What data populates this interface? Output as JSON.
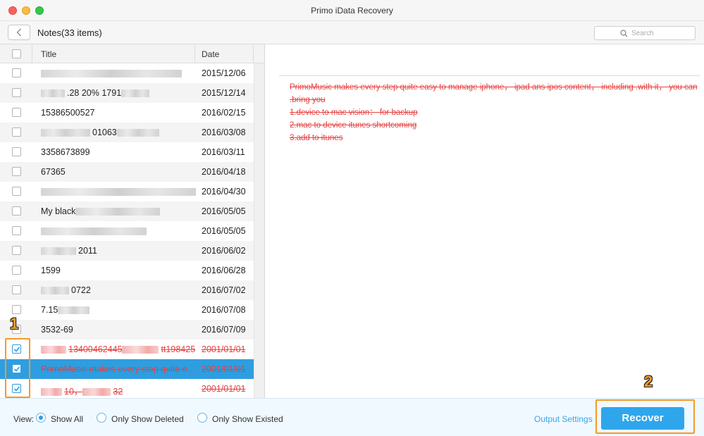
{
  "window": {
    "title": "Primo iData Recovery"
  },
  "toolbar": {
    "breadcrumb": "Notes(33 items)",
    "search_placeholder": "Search"
  },
  "table": {
    "headers": {
      "title": "Title",
      "date": "Date"
    },
    "rows": [
      {
        "prefix": "",
        "suffix": "",
        "date": "2015/12/06",
        "checked": false,
        "deleted": false,
        "blurred_title": true
      },
      {
        "prefix": "",
        "suffix": ".28 20%    1791",
        "date": "2015/12/14",
        "checked": false,
        "deleted": false,
        "blurred_title": true
      },
      {
        "prefix": "15386500527",
        "suffix": "",
        "date": "2016/02/15",
        "checked": false,
        "deleted": false,
        "blurred_title": false
      },
      {
        "prefix": "",
        "suffix": "01063",
        "date": "2016/03/08",
        "checked": false,
        "deleted": false,
        "blurred_title": true
      },
      {
        "prefix": "3358673899",
        "suffix": "",
        "date": "2016/03/11",
        "checked": false,
        "deleted": false,
        "blurred_title": false
      },
      {
        "prefix": "67365",
        "suffix": "",
        "date": "2016/04/18",
        "checked": false,
        "deleted": false,
        "blurred_title": false
      },
      {
        "prefix": "",
        "suffix": "",
        "date": "2016/04/30",
        "checked": false,
        "deleted": false,
        "blurred_title": true
      },
      {
        "prefix": "My black",
        "suffix": "",
        "date": "2016/05/05",
        "checked": false,
        "deleted": false,
        "blurred_title": true
      },
      {
        "prefix": "",
        "suffix": "",
        "date": "2016/05/05",
        "checked": false,
        "deleted": false,
        "blurred_title": true
      },
      {
        "prefix": "",
        "suffix": "2011",
        "date": "2016/06/02",
        "checked": false,
        "deleted": false,
        "blurred_title": true
      },
      {
        "prefix": "1599",
        "suffix": "",
        "date": "2016/06/28",
        "checked": false,
        "deleted": false,
        "blurred_title": false
      },
      {
        "prefix": "",
        "suffix": "0722",
        "date": "2016/07/02",
        "checked": false,
        "deleted": false,
        "blurred_title": true
      },
      {
        "prefix": "7.15",
        "suffix": "",
        "date": "2016/07/08",
        "checked": false,
        "deleted": false,
        "blurred_title": true
      },
      {
        "prefix": "3532-69",
        "suffix": "",
        "date": "2016/07/09",
        "checked": false,
        "deleted": false,
        "blurred_title": false
      },
      {
        "prefix": "",
        "suffix": "13400462445",
        "suffix2": "tt198425",
        "date": "2001/01/01",
        "checked": true,
        "deleted": true,
        "blurred_title": true
      },
      {
        "prefix": "PrimoMusic makes every step quite easy to manage iphone",
        "suffix": "",
        "date": "2001/01/01",
        "checked": true,
        "deleted": true,
        "blurred_title": false,
        "selected": true
      },
      {
        "prefix": "",
        "suffix": "10，",
        "suffix2": "32",
        "date": "2001/01/01",
        "checked": true,
        "deleted": true,
        "blurred_title": true
      }
    ]
  },
  "detail": {
    "lines": [
      "PrimoMusic makes every step quite easy to manage iphone， ipad ans ipos content， including .with it， you can .bring you",
      "1.device to mac vision： for backup",
      "2.mac to device itunes shortcoming",
      "3.add to itunes"
    ]
  },
  "footer": {
    "view_label": "View:",
    "options": [
      "Show All",
      "Only Show Deleted",
      "Only Show Existed"
    ],
    "selected_option": 0,
    "output_settings": "Output Settings",
    "recover": "Recover"
  },
  "annotations": {
    "one": "1",
    "two": "2"
  },
  "colors": {
    "accent": "#2e9ee0",
    "deleted_text": "#e84040",
    "annotation": "#f39a2b"
  }
}
